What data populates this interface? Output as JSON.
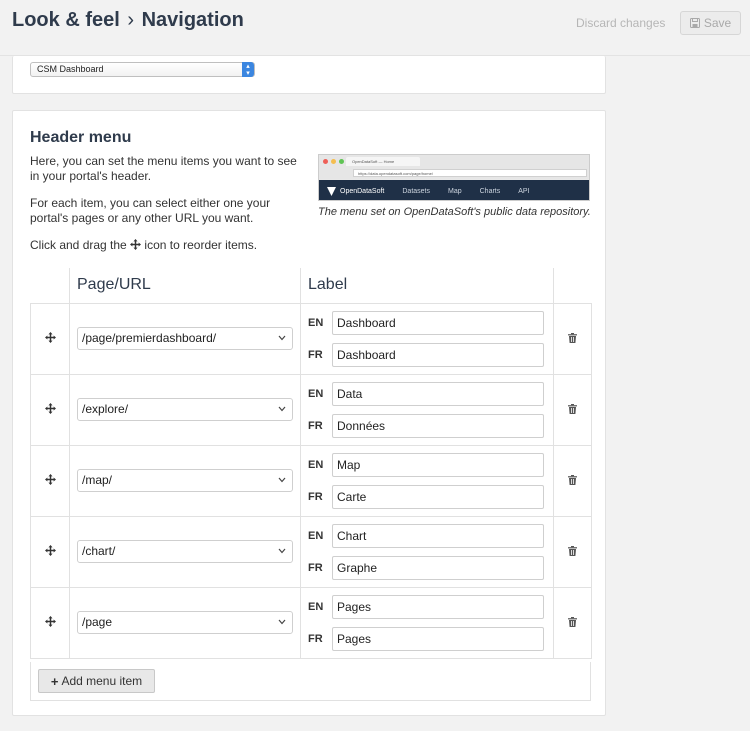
{
  "header": {
    "breadcrumb_parent": "Look & feel",
    "breadcrumb_separator": "›",
    "breadcrumb_current": "Navigation",
    "discard_label": "Discard changes",
    "save_label": "Save"
  },
  "dashboard_select": {
    "value": "CSM Dashboard"
  },
  "header_menu": {
    "title": "Header menu",
    "intro_1": "Here, you can set the menu items you want to see in your portal's header.",
    "intro_2": "For each item, you can select either one your portal's pages or any other URL you want.",
    "intro_3_before": "Click and drag the",
    "intro_3_after": "icon to reorder items.",
    "preview_caption": "The menu set on OpenDataSoft's public data repository.",
    "preview": {
      "tab_title": "OpenDataSoft — Home",
      "url": "https://data.opendatasoft.com/page/home/",
      "logo_text": "OpenDataSoft",
      "nav_items": [
        "Datasets",
        "Map",
        "Charts",
        "API"
      ]
    },
    "columns": {
      "page_url": "Page/URL",
      "label": "Label"
    },
    "lang_en": "EN",
    "lang_fr": "FR",
    "rows": [
      {
        "page": "/page/premierdashboard/",
        "en": "Dashboard",
        "fr": "Dashboard"
      },
      {
        "page": "/explore/",
        "en": "Data",
        "fr": "Données"
      },
      {
        "page": "/map/",
        "en": "Map",
        "fr": "Carte"
      },
      {
        "page": "/chart/",
        "en": "Chart",
        "fr": "Graphe"
      },
      {
        "page": "/page",
        "en": "Pages",
        "fr": "Pages"
      }
    ],
    "add_label": "Add menu item"
  },
  "colors": {
    "title": "#2f3b4c",
    "preview_nav": "#1f3047",
    "select_accent": "#3b86e0"
  }
}
